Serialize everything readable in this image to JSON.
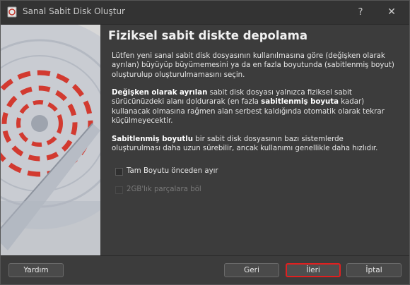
{
  "window": {
    "title": "Sanal Sabit Disk Oluştur",
    "help_label": "?",
    "close_label": "✕"
  },
  "content": {
    "heading": "Fiziksel sabit diskte depolama",
    "intro": "Lütfen yeni sanal sabit disk dosyasının kullanılmasına göre (değişken olarak ayrılan) büyüyüp büyümemesini ya da en fazla boyutunda (sabitlenmiş boyut) oluşturulup oluşturulmamasını seçin.",
    "dynamic": {
      "bold1": "Değişken olarak ayrılan",
      "text1": " sabit disk dosyası yalnızca fiziksel sabit sürücünüzdeki alanı doldurarak (en fazla ",
      "bold2": "sabitlenmiş boyuta",
      "text2": " kadar) kullanacak olmasına rağmen alan serbest kaldığında otomatik olarak tekrar küçülmeyecektir."
    },
    "fixed": {
      "bold": "Sabitlenmiş boyutlu",
      "text": " bir sabit disk dosyasının bazı sistemlerde oluşturulması daha uzun sürebilir, ancak kullanımı genellikle daha hızlıdır."
    },
    "checkbox_prealloc": "Tam Boyutu önceden ayır",
    "checkbox_split": "2GB'lık parçalara böl"
  },
  "buttons": {
    "help": "Yardım",
    "back": "Geri",
    "next": "İleri",
    "cancel": "İptal"
  },
  "colors": {
    "highlight": "#e02020",
    "art_red": "#d23a30"
  }
}
